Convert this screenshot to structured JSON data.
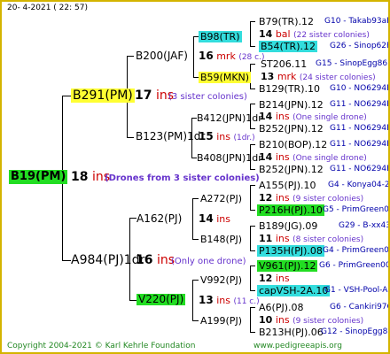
{
  "header": {
    "date": "20-   4-2021 (  22:  57)"
  },
  "footer": {
    "copyright": "Copyright 2004-2021 © Karl Kehrle Foundation",
    "url": "www.pedigreeapis.org"
  },
  "root": {
    "label": "B19(PM)",
    "num": "18",
    "ins": "ins",
    "note": "(Drones from 3 sister colonies)"
  },
  "gen1": [
    {
      "label": "B291(PM)",
      "num": "17",
      "ins": "ins",
      "note": "(3 sister colonies)"
    },
    {
      "label": "A984(PJ)1dr",
      "num": "16",
      "ins": "ins",
      "note": "(Only one drone)"
    }
  ],
  "gen2": [
    {
      "label": "B200(JAF)"
    },
    {
      "label": "B123(PM)1dr",
      "num": "15",
      "ins": "ins",
      "note": "(1dr.)"
    },
    {
      "label": "A162(PJ)",
      "num": "14",
      "ins": "ins"
    },
    {
      "label": "V220(PJ)",
      "num": "13",
      "ins": "ins",
      "note": "(11 c.)"
    }
  ],
  "gen3": [
    {
      "label": "B98(TR)"
    },
    {
      "label": "B59(MKN)"
    },
    {
      "label": "B412(JPN)1dr",
      "num": "14",
      "ins": "ins"
    },
    {
      "label": "B408(JPN)1dr",
      "num": "14",
      "ins": "ins"
    },
    {
      "label": "A272(PJ)"
    },
    {
      "label": "B148(PJ)"
    },
    {
      "label": "V992(PJ)"
    },
    {
      "label": "A199(PJ)"
    }
  ],
  "b200_mid": {
    "num": "16",
    "ins": "mrk",
    "note": "(28 c.)"
  },
  "leaves": [
    {
      "row": "B79(TR).12",
      "right": "G10 - Takab93aR"
    },
    {
      "row": "14",
      "ins": "bal",
      "note": "(22 sister colonies)"
    },
    {
      "row": "B54(TR).12",
      "right": "G26 - Sinop62R"
    },
    {
      "row": "ST206.11",
      "right": "G15 - SinopEgg86R"
    },
    {
      "row": "13",
      "ins": "mrk",
      "note": "(24 sister colonies)"
    },
    {
      "row": "B129(TR).10",
      "right": "G10 - NO6294R"
    },
    {
      "row": "B214(JPN).12",
      "right": "G11 - NO6294R"
    },
    {
      "row": "14",
      "ins": "ins",
      "note": "(One single drone)"
    },
    {
      "row": "B252(JPN).12",
      "right": "G11 - NO6294R"
    },
    {
      "row": "B210(BOP).12",
      "right": "G11 - NO6294R"
    },
    {
      "row": "14",
      "ins": "ins",
      "note": "(One single drone)"
    },
    {
      "row": "B252(JPN).12",
      "right": "G11 - NO6294R"
    },
    {
      "row": "A155(PJ).10",
      "right": "G4 - Konya04-2"
    },
    {
      "row": "12",
      "ins": "ins",
      "note": "(9 sister colonies)"
    },
    {
      "row": "P216H(PJ).10",
      "right": "G5 - PrimGreen00"
    },
    {
      "row": "B189(JG).09",
      "right": "G29 - B-xx43"
    },
    {
      "row": "11",
      "ins": "ins",
      "note": "(8 sister colonies)"
    },
    {
      "row": "P135H(PJ).08",
      "right": "G4 - PrimGreen00"
    },
    {
      "row": "V961(PJ).12",
      "right": "G6 - PrimGreen00"
    },
    {
      "row": "12",
      "ins": "ins",
      "note": ""
    },
    {
      "row": "capVSH-2A.10",
      "right": "G1 - VSH-Pool-AR"
    },
    {
      "row": "A6(PJ).08",
      "right": "G6 - Cankiri97Q"
    },
    {
      "row": "10",
      "ins": "ins",
      "note": "(9 sister colonies)"
    },
    {
      "row": "B213H(PJ).06",
      "right": "G12 - SinopEgg86R"
    }
  ]
}
